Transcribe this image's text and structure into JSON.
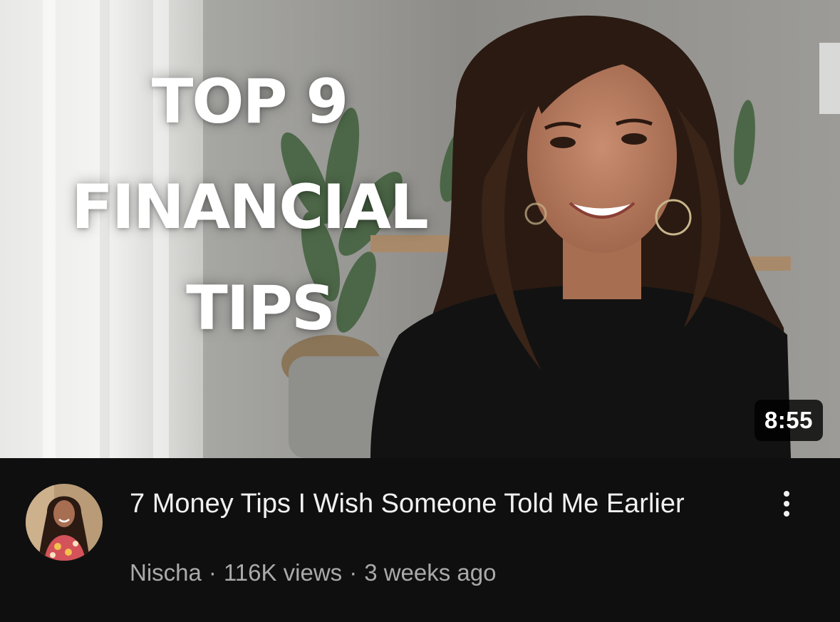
{
  "thumbnail": {
    "overlay_lines": [
      "TOP 9",
      "FINANCIAL",
      "TIPS"
    ],
    "duration": "8:55"
  },
  "video": {
    "title": "7 Money Tips I Wish Someone Told Me Earlier",
    "channel": "Nischa",
    "separator": "·",
    "views": "116K views",
    "age": "3 weeks ago"
  },
  "icons": {
    "more": "more-vert-icon",
    "avatar": "channel-avatar"
  },
  "colors": {
    "background": "#0f0f0f",
    "title_text": "#f1f1f1",
    "secondary_text": "#aaaaaa",
    "duration_badge": "#000000"
  }
}
